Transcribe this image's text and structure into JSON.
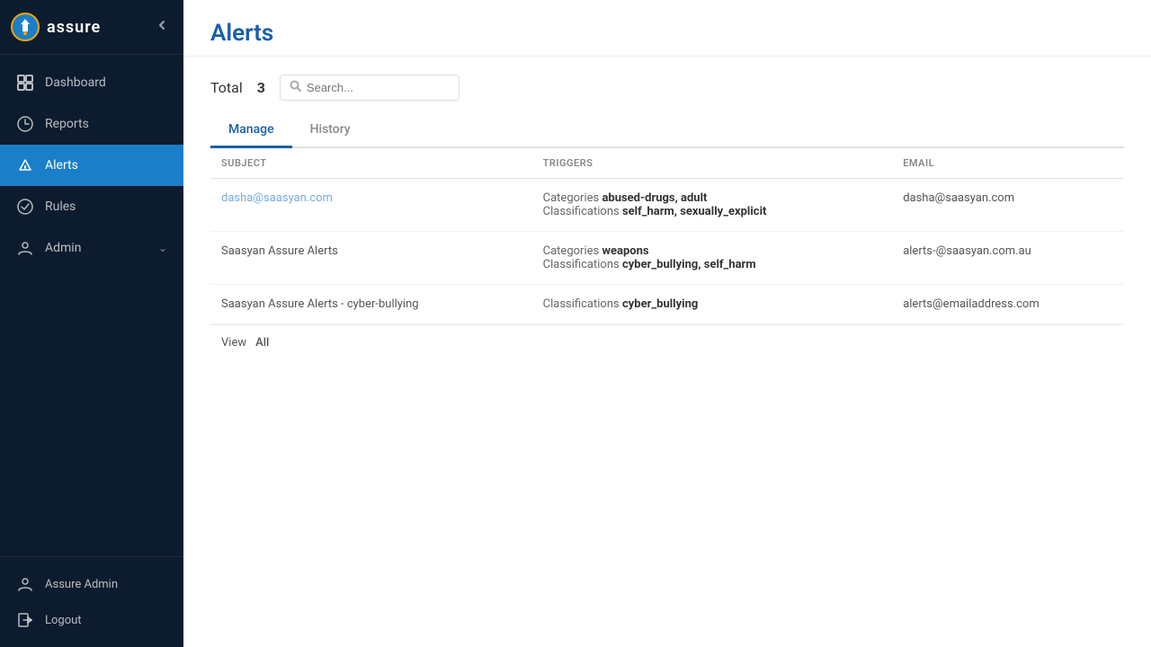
{
  "sidebar": {
    "logo_text": "assure",
    "nav_items": [
      {
        "id": "dashboard",
        "label": "Dashboard",
        "icon": "dashboard-icon",
        "active": false
      },
      {
        "id": "reports",
        "label": "Reports",
        "icon": "reports-icon",
        "active": false
      },
      {
        "id": "alerts",
        "label": "Alerts",
        "icon": "alerts-icon",
        "active": true
      },
      {
        "id": "rules",
        "label": "Rules",
        "icon": "rules-icon",
        "active": false
      },
      {
        "id": "admin",
        "label": "Admin",
        "icon": "admin-icon",
        "active": false,
        "has_arrow": true
      }
    ],
    "footer_items": [
      {
        "id": "user",
        "label": "Assure Admin",
        "icon": "user-icon"
      },
      {
        "id": "logout",
        "label": "Logout",
        "icon": "logout-icon"
      }
    ]
  },
  "header": {
    "title": "Alerts"
  },
  "content": {
    "total_label": "Total",
    "total_count": "3",
    "search_placeholder": "Search...",
    "tabs": [
      {
        "id": "manage",
        "label": "Manage",
        "active": true
      },
      {
        "id": "history",
        "label": "History",
        "active": false
      }
    ],
    "table": {
      "columns": [
        {
          "id": "subject",
          "label": "SUBJECT"
        },
        {
          "id": "triggers",
          "label": "TRIGGERS"
        },
        {
          "id": "email",
          "label": "EMAIL"
        }
      ],
      "rows": [
        {
          "subject": "dasha@saasyan.com",
          "subject_is_link": true,
          "triggers_cat_label": "Categories",
          "triggers_cat_value": "abused-drugs, adult",
          "triggers_cls_label": "Classifications",
          "triggers_cls_value": "self_harm, sexually_explicit",
          "email": "dasha@saasyan.com"
        },
        {
          "subject": "Saasyan Assure Alerts",
          "subject_is_link": false,
          "triggers_cat_label": "Categories",
          "triggers_cat_value": "weapons",
          "triggers_cls_label": "Classifications",
          "triggers_cls_value": "cyber_bullying, self_harm",
          "email": "alerts-@saasyan.com.au"
        },
        {
          "subject": "Saasyan Assure Alerts - cyber-bullying",
          "subject_is_link": false,
          "triggers_cat_label": "",
          "triggers_cat_value": "",
          "triggers_cls_label": "Classifications",
          "triggers_cls_value": "cyber_bullying",
          "email": "alerts@emailaddress.com"
        }
      ]
    },
    "view_label": "View",
    "view_all_label": "All"
  }
}
